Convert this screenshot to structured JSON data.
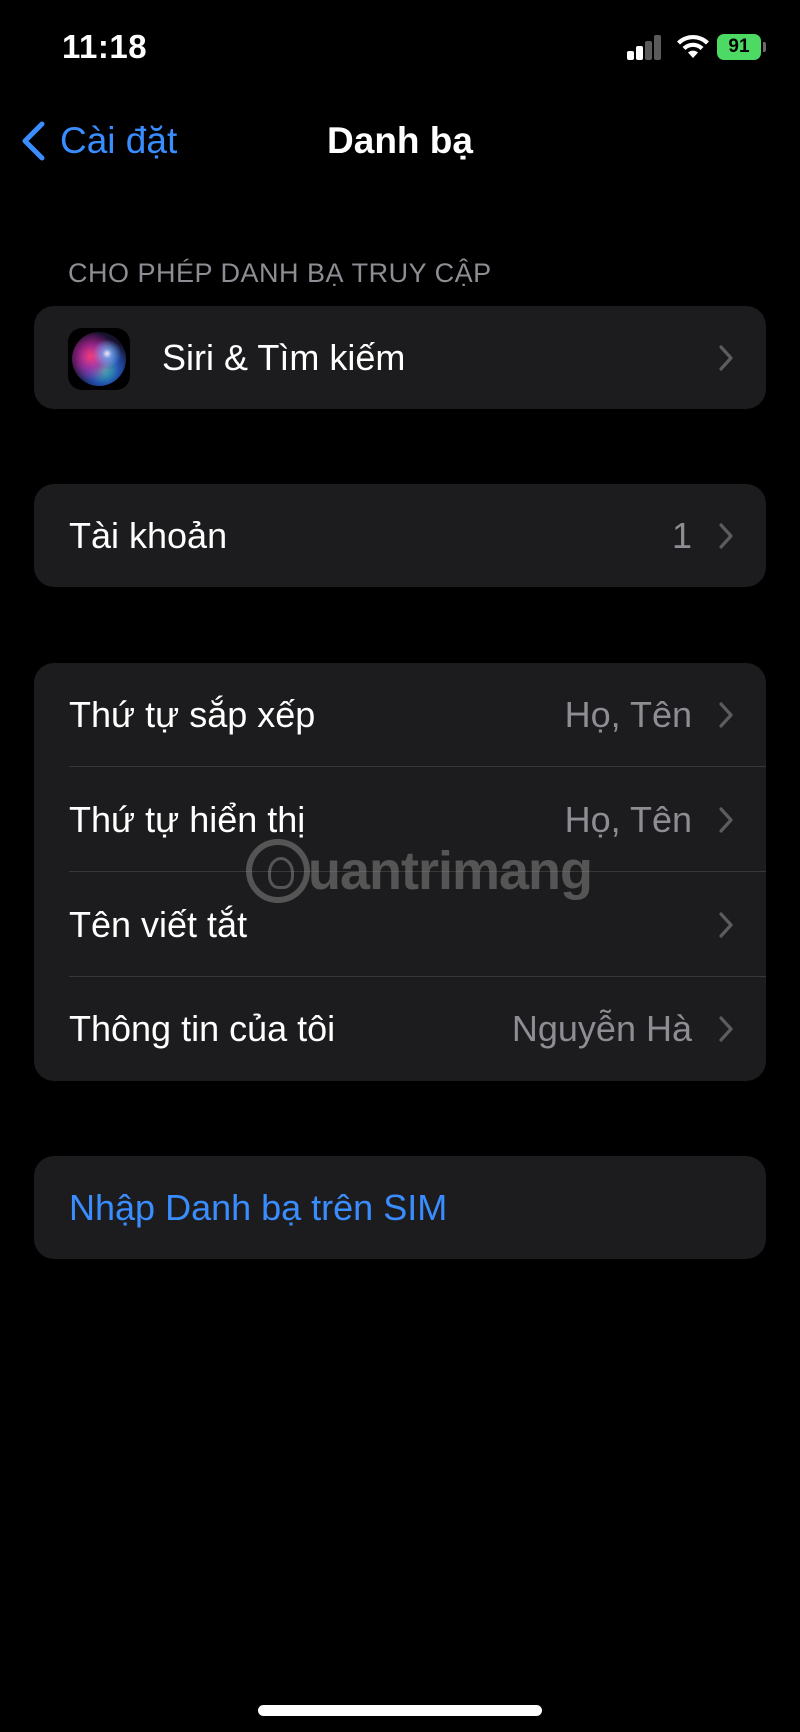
{
  "status_bar": {
    "time": "11:18",
    "battery_level": "91",
    "battery_color": "#4cd964"
  },
  "nav": {
    "back_label": "Cài đặt",
    "title": "Danh bạ"
  },
  "section_allow": {
    "header": "CHO PHÉP DANH BẠ TRUY CẬP",
    "items": [
      {
        "label": "Siri & Tìm kiếm",
        "icon": "siri-icon"
      }
    ]
  },
  "section_accounts": {
    "items": [
      {
        "label": "Tài khoản",
        "value": "1"
      }
    ]
  },
  "section_display": {
    "items": [
      {
        "label": "Thứ tự sắp xếp",
        "value": "Họ, Tên"
      },
      {
        "label": "Thứ tự hiển thị",
        "value": "Họ, Tên"
      },
      {
        "label": "Tên viết tắt",
        "value": ""
      },
      {
        "label": "Thông tin của tôi",
        "value": "Nguyễn Hà"
      }
    ]
  },
  "section_sim": {
    "items": [
      {
        "label": "Nhập Danh bạ trên SIM"
      }
    ]
  },
  "watermark": {
    "text": "uantrimang"
  },
  "colors": {
    "accent": "#3a8dff",
    "background": "#000000",
    "cell": "#1c1c1e",
    "secondary_text": "#8d8d93"
  }
}
